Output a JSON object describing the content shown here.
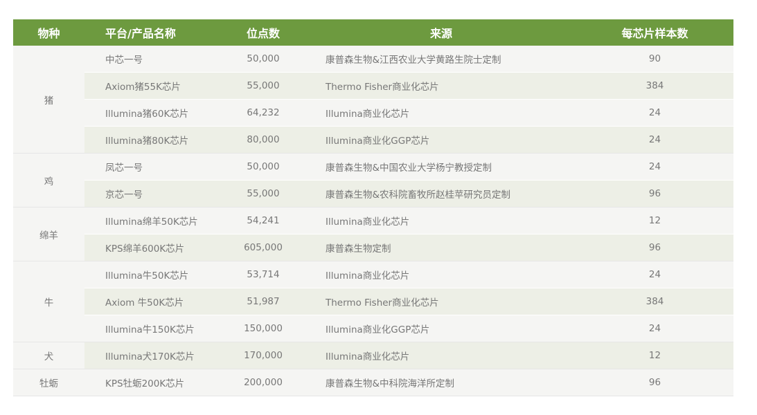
{
  "headers": {
    "species": "物种",
    "platform": "平台/产品名称",
    "sites": "位点数",
    "source": "来源",
    "samples": "每芯片样本数"
  },
  "groups": [
    {
      "species": "猪",
      "rows": [
        {
          "platform": "中芯一号",
          "sites": "50,000",
          "source": "康普森生物&江西农业大学黄路生院士定制",
          "samples": "90"
        },
        {
          "platform": "Axiom猪55K芯片",
          "sites": "55,000",
          "source": "Thermo Fisher商业化芯片",
          "samples": "384"
        },
        {
          "platform": "Illumina猪60K芯片",
          "sites": "64,232",
          "source": "Illumina商业化芯片",
          "samples": "24"
        },
        {
          "platform": "Illumina猪80K芯片",
          "sites": "80,000",
          "source": "Illumina商业化GGP芯片",
          "samples": "24"
        }
      ]
    },
    {
      "species": "鸡",
      "rows": [
        {
          "platform": "凤芯一号",
          "sites": "50,000",
          "source": "康普森生物&中国农业大学杨宁教授定制",
          "samples": "24"
        },
        {
          "platform": "京芯一号",
          "sites": "55,000",
          "source": "康普森生物&农科院畜牧所赵桂苹研究员定制",
          "samples": "96"
        }
      ]
    },
    {
      "species": "绵羊",
      "rows": [
        {
          "platform": "Illumina绵羊50K芯片",
          "sites": "54,241",
          "source": "Illumina商业化芯片",
          "samples": "12"
        },
        {
          "platform": "KPS绵羊600K芯片",
          "sites": "605,000",
          "source": "康普森生物定制",
          "samples": "96"
        }
      ]
    },
    {
      "species": "牛",
      "rows": [
        {
          "platform": "Illumina牛50K芯片",
          "sites": "53,714",
          "source": "Illumina商业化芯片",
          "samples": "24"
        },
        {
          "platform": "Axiom 牛50K芯片",
          "sites": "51,987",
          "source": "Thermo Fisher商业化芯片",
          "samples": "384"
        },
        {
          "platform": "Illumina牛150K芯片",
          "sites": "150,000",
          "source": "Illumina商业化GGP芯片",
          "samples": "24"
        }
      ]
    },
    {
      "species": "犬",
      "rows": [
        {
          "platform": "Illumina犬170K芯片",
          "sites": "170,000",
          "source": "Illumina商业化芯片",
          "samples": "12"
        }
      ]
    },
    {
      "species": "牡蛎",
      "rows": [
        {
          "platform": "KPS牡蛎200K芯片",
          "sites": "200,000",
          "source": "康普森生物&中科院海洋所定制",
          "samples": "96"
        }
      ]
    }
  ]
}
